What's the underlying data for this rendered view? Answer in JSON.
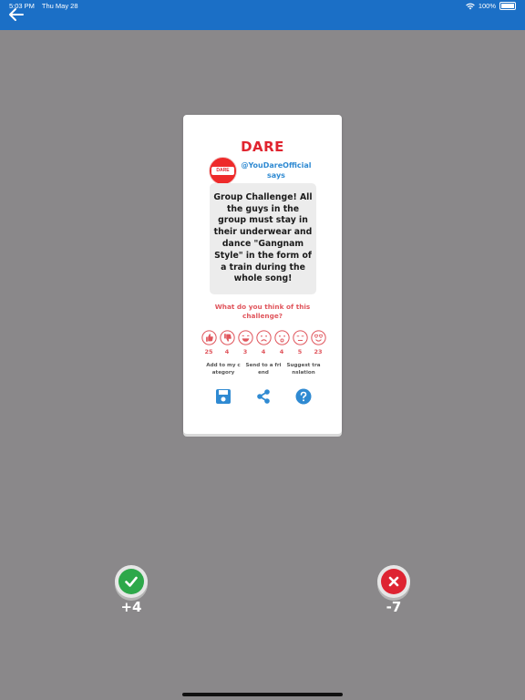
{
  "status_bar": {
    "time": "5:03 PM",
    "date": "Thu May 28",
    "battery": "100%"
  },
  "colors": {
    "header_blue": "#1b6fc6",
    "dare_red": "#e0242f",
    "author_blue": "#2f8ad2",
    "accept_green": "#2da84a",
    "reject_red": "#de2432",
    "background_gray": "#8a888a"
  },
  "card": {
    "title": "DARE",
    "author": "@YouDareOfficial says",
    "avatar_text": "DARE",
    "dare_text": "Group Challenge! All the guys in the group must stay in their underwear and dance \"Gangnam Style\" in the form of a train during the whole song!",
    "question": "What do you think of this challenge?",
    "reactions": [
      {
        "icon": "thumbs-up-icon",
        "count": "25"
      },
      {
        "icon": "thumbs-down-icon",
        "count": "4"
      },
      {
        "icon": "laughing-face-icon",
        "count": "3"
      },
      {
        "icon": "sad-face-icon",
        "count": "4"
      },
      {
        "icon": "surprised-face-icon",
        "count": "4"
      },
      {
        "icon": "neutral-face-icon",
        "count": "5"
      },
      {
        "icon": "love-face-icon",
        "count": "23"
      }
    ],
    "actions": [
      {
        "label": "Add to my category",
        "icon": "save-icon"
      },
      {
        "label": "Send to a friend",
        "icon": "share-icon"
      },
      {
        "label": "Suggest translation",
        "icon": "help-icon"
      }
    ]
  },
  "votes": {
    "accept_score": "+4",
    "reject_score": "-7"
  }
}
